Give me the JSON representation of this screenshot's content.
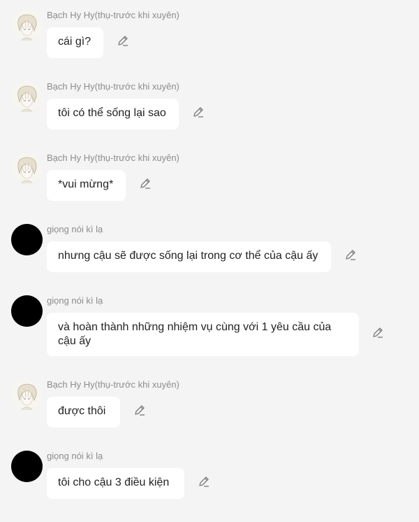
{
  "messages": [
    {
      "sender": "Bạch Hy Hy(thụ-trước khi xuyên)",
      "avatar": "white-haired-boy-avatar",
      "text": "cái gì?"
    },
    {
      "sender": "Bạch Hy Hy(thụ-trước khi xuyên)",
      "avatar": "white-haired-boy-avatar",
      "text": "tôi có thể sống lại sao"
    },
    {
      "sender": "Bạch Hy Hy(thụ-trước khi xuyên)",
      "avatar": "white-haired-boy-avatar",
      "text": "*vui mừng*"
    },
    {
      "sender": "giọng nói kì lạ",
      "avatar": "black-circle-avatar",
      "text": "nhưng cậu sẽ được sống lại trong cơ thể của cậu ấy"
    },
    {
      "sender": "giọng nói kì lạ",
      "avatar": "black-circle-avatar",
      "text": "và hoàn thành những nhiệm vụ cùng với 1 yêu cầu của cậu ấy"
    },
    {
      "sender": "Bạch Hy Hy(thụ-trước khi xuyên)",
      "avatar": "white-haired-boy-avatar",
      "text": "được thôi"
    },
    {
      "sender": "giọng nói kì lạ",
      "avatar": "black-circle-avatar",
      "text": "tôi cho cậu 3 điều kiện"
    }
  ],
  "icons": {
    "edit": "pencil-edit-icon"
  },
  "colors": {
    "background": "#f4f4f4",
    "bubble": "#ffffff",
    "name": "#8c8c8c",
    "text": "#222222",
    "dark_avatar": "#000000"
  }
}
